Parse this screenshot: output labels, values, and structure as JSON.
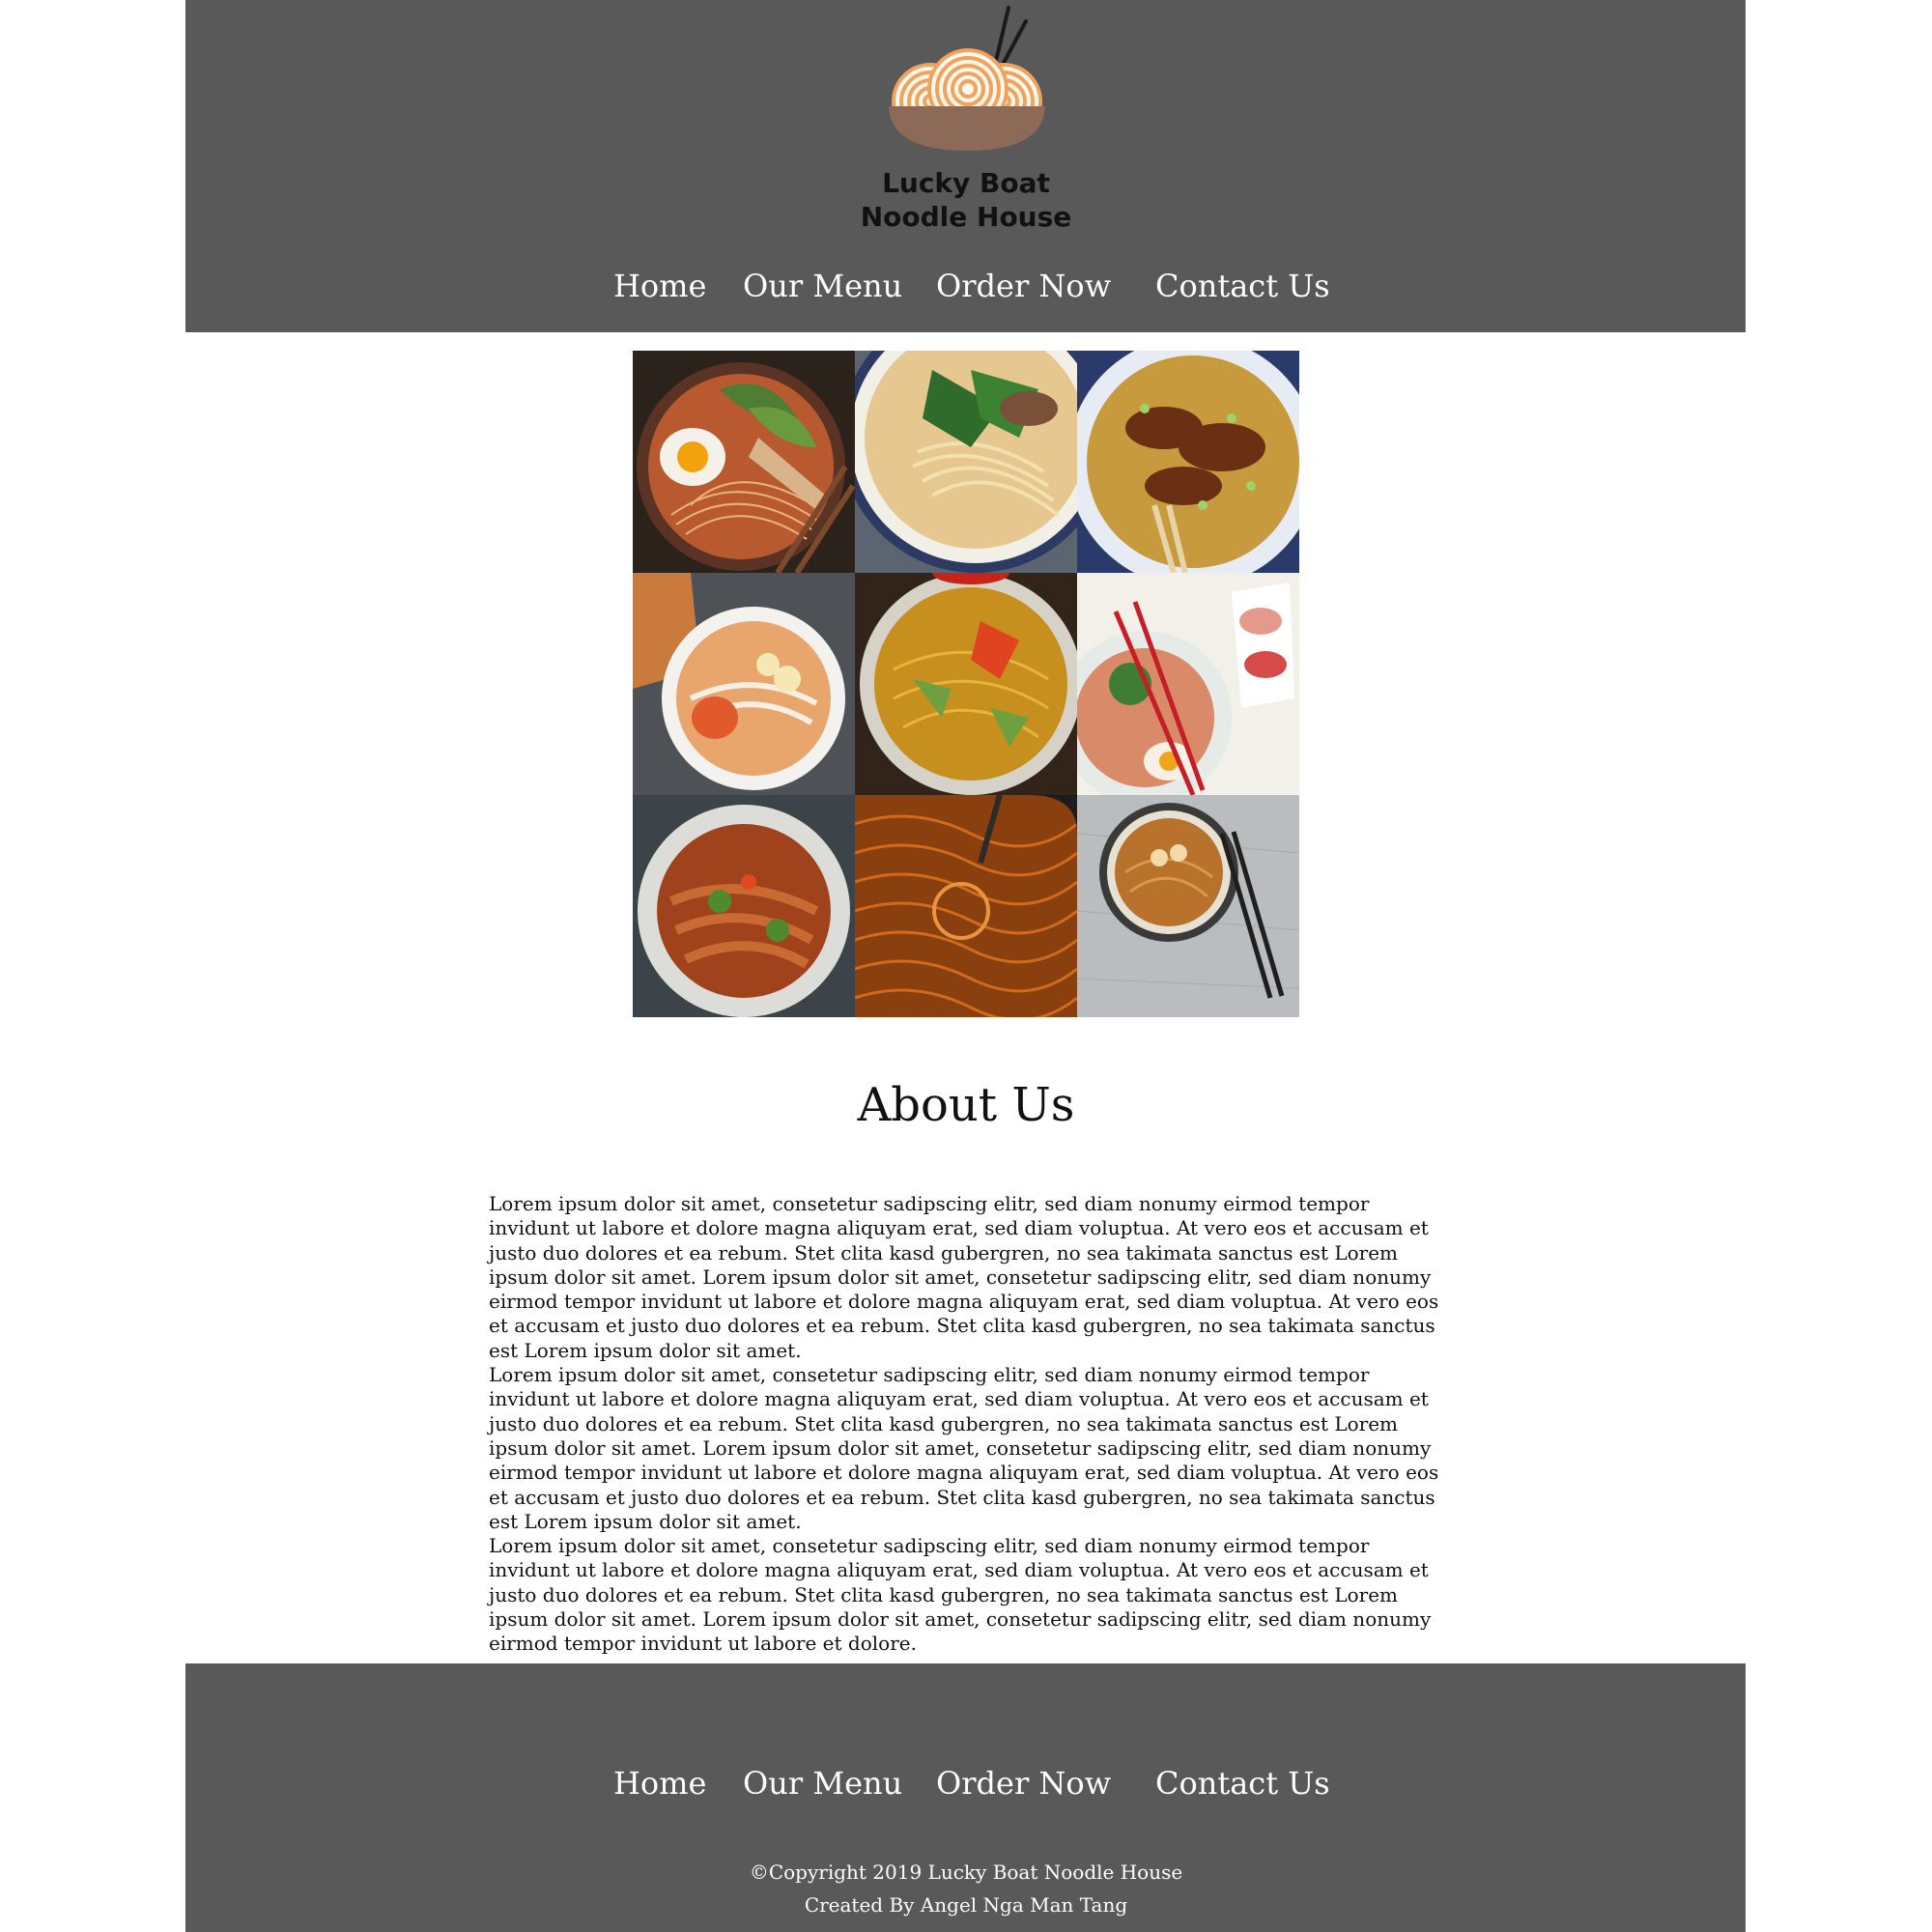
{
  "header": {
    "brand_line1": "Lucky Boat",
    "brand_line2": "Noodle House",
    "logo_icon": "noodle-bowl-icon",
    "colors": {
      "background": "#595959",
      "bowl": "#8c6a57",
      "noodle": "#f0a35c"
    }
  },
  "nav": {
    "items": [
      {
        "label": "Home"
      },
      {
        "label": "Our Menu"
      },
      {
        "label": "Order Now"
      },
      {
        "label": "Contact Us"
      }
    ]
  },
  "gallery": {
    "images": [
      "ramen-egg-bokchoy-photo",
      "noodle-soup-cilantro-photo",
      "crispy-fried-noodles-photo",
      "rice-noodle-soup-photo",
      "stir-fried-noodles-photo",
      "ramen-chopsticks-sashimi-photo",
      "wide-noodle-stir-fry-photo",
      "spaghetti-noodles-pan-photo",
      "instant-noodle-bowl-photo"
    ]
  },
  "about": {
    "title": "About Us",
    "paragraphs": [
      "Lorem ipsum dolor sit amet, consetetur sadipscing elitr, sed diam nonumy eirmod tempor invidunt ut labore et dolore magna aliquyam erat, sed diam voluptua. At vero eos et accusam et justo duo dolores et ea rebum. Stet clita kasd gubergren, no sea takimata sanctus est Lorem ipsum dolor sit amet. Lorem ipsum dolor sit amet, consetetur sadipscing elitr, sed diam nonumy eirmod tempor invidunt ut labore et dolore magna aliquyam erat, sed diam voluptua. At vero eos et accusam et justo duo dolores et ea rebum. Stet clita kasd gubergren, no sea takimata sanctus est Lorem ipsum dolor sit amet.",
      "Lorem ipsum dolor sit amet, consetetur sadipscing elitr, sed diam nonumy eirmod tempor invidunt ut labore et dolore magna aliquyam erat, sed diam voluptua. At vero eos et accusam et justo duo dolores et ea rebum. Stet clita kasd gubergren, no sea takimata sanctus est Lorem ipsum dolor sit amet. Lorem ipsum dolor sit amet, consetetur sadipscing elitr, sed diam nonumy eirmod tempor invidunt ut labore et dolore magna aliquyam erat, sed diam voluptua. At vero eos et accusam et justo duo dolores et ea rebum. Stet clita kasd gubergren, no sea takimata sanctus est Lorem ipsum dolor sit amet.",
      "Lorem ipsum dolor sit amet, consetetur sadipscing elitr, sed diam nonumy eirmod tempor invidunt ut labore et dolore magna aliquyam erat, sed diam voluptua. At vero eos et accusam et justo duo dolores et ea rebum. Stet clita kasd gubergren, no sea takimata sanctus est Lorem ipsum dolor sit amet. Lorem ipsum dolor sit amet, consetetur sadipscing elitr, sed diam nonumy eirmod tempor invidunt ut labore et dolore."
    ]
  },
  "footer": {
    "copyright": "©Copyright 2019 Lucky Boat Noodle House",
    "credit": "Created By Angel Nga Man Tang"
  }
}
